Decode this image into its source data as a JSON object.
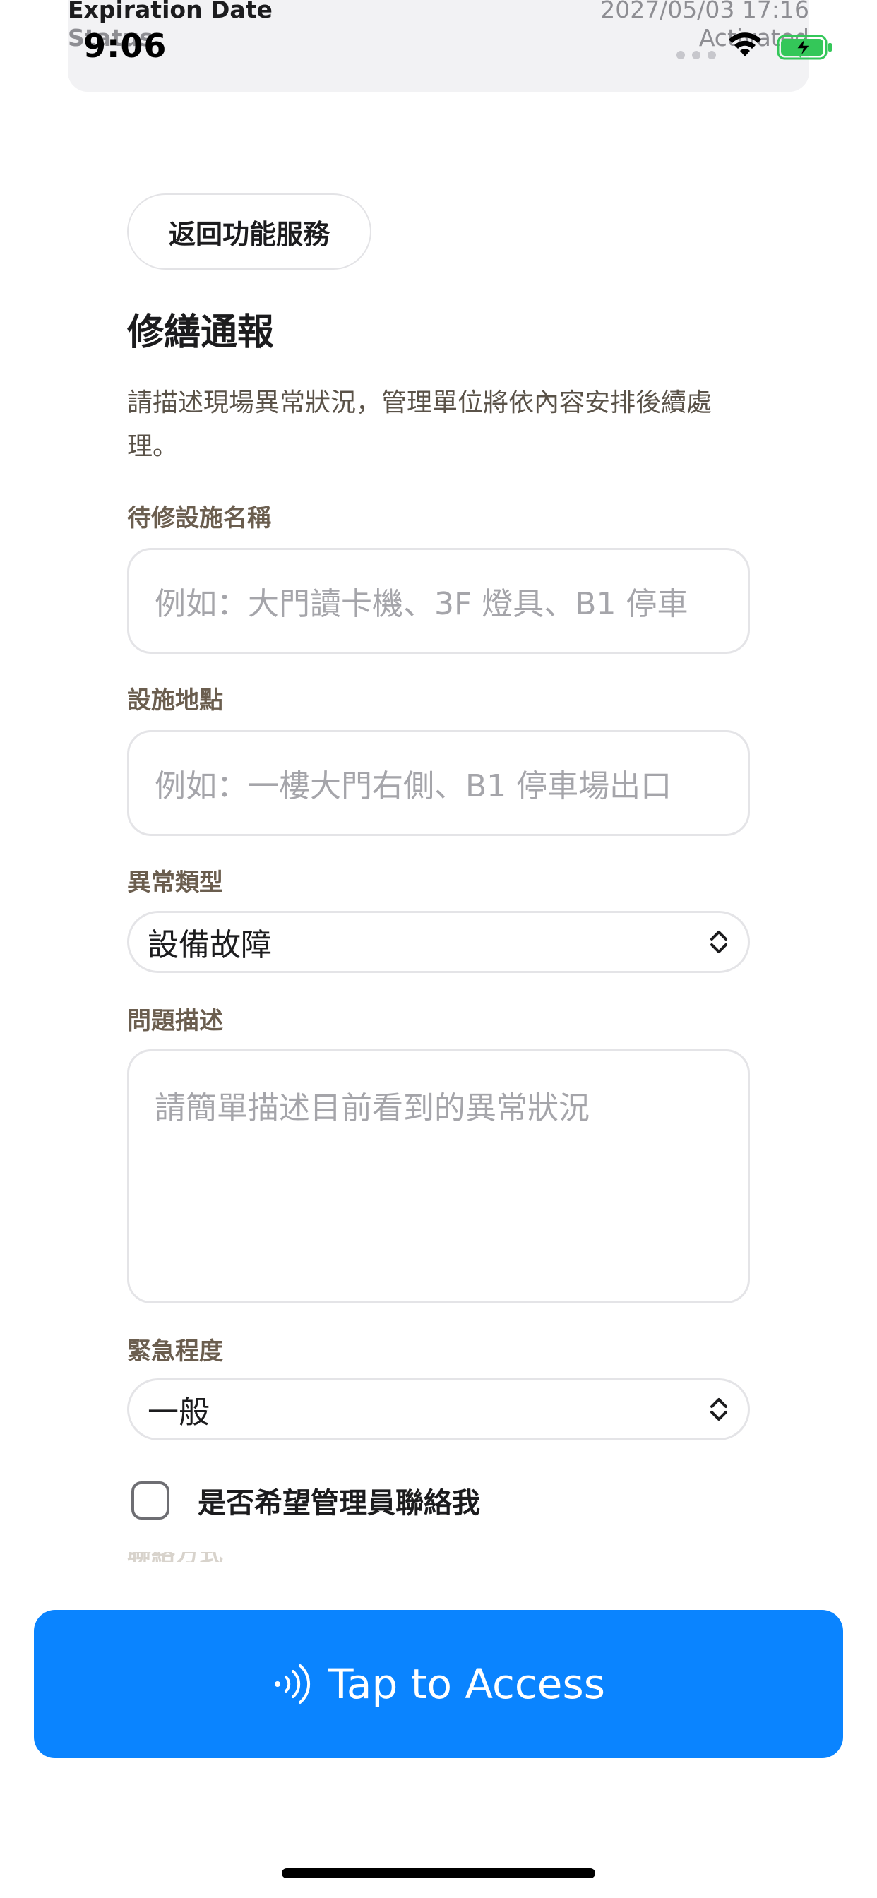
{
  "status_bar": {
    "time": "9:06"
  },
  "top_card": {
    "row1_label": "Expiration Date",
    "row1_value": "2027/05/03 17:16",
    "row2_label": "Status",
    "row2_value": "Activated"
  },
  "back_button": "返回功能服務",
  "title": "修繕通報",
  "description": "請描述現場異常狀況，管理單位將依內容安排後續處理。",
  "form": {
    "facility_name": {
      "label": "待修設施名稱",
      "placeholder": "例如：大門讀卡機、3F 燈具、B1 停車"
    },
    "location": {
      "label": "設施地點",
      "placeholder": "例如：一樓大門右側、B1 停車場出口"
    },
    "issue_type": {
      "label": "異常類型",
      "selected": "設備故障"
    },
    "issue_description": {
      "label": "問題描述",
      "placeholder": "請簡單描述目前看到的異常狀況"
    },
    "urgency": {
      "label": "緊急程度",
      "selected": "一般"
    },
    "contact_me": {
      "label": "是否希望管理員聯絡我",
      "checked": false
    },
    "next_label_partial": "聯絡方式"
  },
  "tap_button": {
    "label": "Tap to Access",
    "icon": "nfc-icon",
    "color": "#0a84ff"
  }
}
